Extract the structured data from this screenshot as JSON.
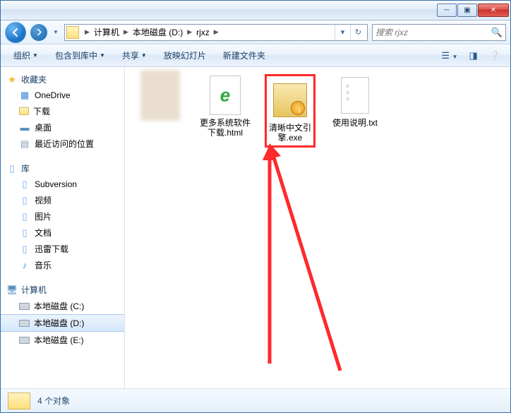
{
  "titlebar": {
    "min": "─",
    "max": "▣",
    "close": "✕"
  },
  "nav": {
    "crumbs": [
      "计算机",
      "本地磁盘 (D:)",
      "rjxz"
    ],
    "search_placeholder": "搜索 rjxz"
  },
  "toolbar": {
    "organize": "组织",
    "include": "包含到库中",
    "share": "共享",
    "slideshow": "放映幻灯片",
    "newfolder": "新建文件夹"
  },
  "sidebar": {
    "favorites": {
      "label": "收藏夹",
      "items": [
        "OneDrive",
        "下载",
        "桌面",
        "最近访问的位置"
      ]
    },
    "libraries": {
      "label": "库",
      "items": [
        "Subversion",
        "视频",
        "图片",
        "文档",
        "迅雷下载",
        "音乐"
      ]
    },
    "computer": {
      "label": "计算机",
      "items": [
        "本地磁盘 (C:)",
        "本地磁盘 (D:)",
        "本地磁盘 (E:)"
      ],
      "selected": 1
    }
  },
  "files": [
    {
      "name": "",
      "type": "image"
    },
    {
      "name": "更多系统软件下载.html",
      "type": "html"
    },
    {
      "name": "清晰中文引擎.exe",
      "type": "exe",
      "highlight": true
    },
    {
      "name": "使用说明.txt",
      "type": "txt"
    }
  ],
  "status": {
    "text": "4 个对象"
  }
}
